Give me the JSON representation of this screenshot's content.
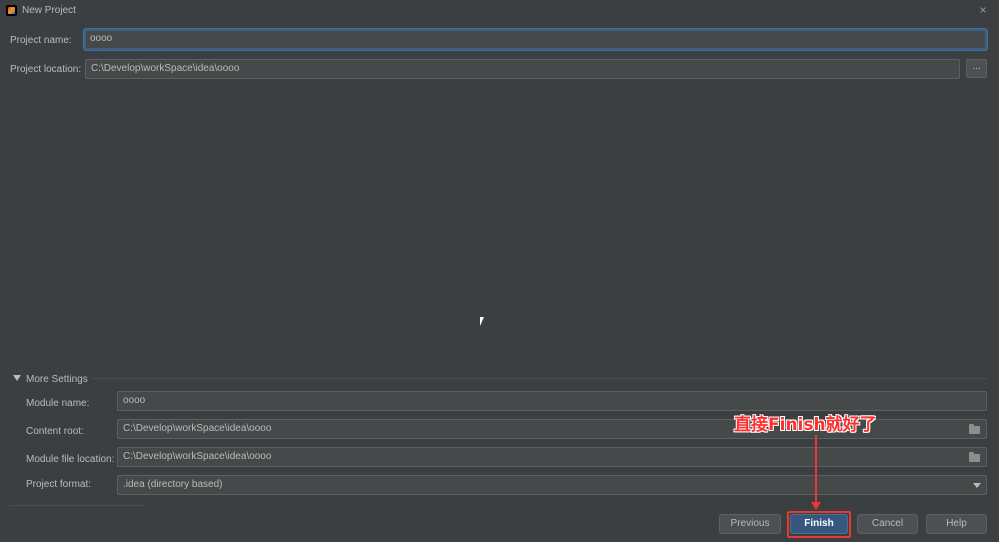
{
  "window": {
    "title": "New Project",
    "close_glyph": "×"
  },
  "project": {
    "name_label": "Project name:",
    "name_value": "oooo",
    "location_label": "Project location:",
    "location_value": "C:\\Develop\\workSpace\\idea\\oooo",
    "browse_label": "..."
  },
  "more_settings": {
    "title": "More Settings",
    "module_name_label": "Module name:",
    "module_name_value": "oooo",
    "content_root_label": "Content root:",
    "content_root_value": "C:\\Develop\\workSpace\\idea\\oooo",
    "module_file_label": "Module file location:",
    "module_file_value": "C:\\Develop\\workSpace\\idea\\oooo",
    "project_format_label": "Project format:",
    "project_format_value": ".idea (directory based)"
  },
  "buttons": {
    "previous": "Previous",
    "finish": "Finish",
    "cancel": "Cancel",
    "help": "Help"
  },
  "annotation": {
    "text": "直接Finish就好了",
    "color": "#ff2f2f"
  },
  "colors": {
    "background": "#3c3f41",
    "field_bg": "#45494a",
    "focus_border": "#3d6185",
    "primary_button": "#365880",
    "highlight": "#e53935"
  }
}
